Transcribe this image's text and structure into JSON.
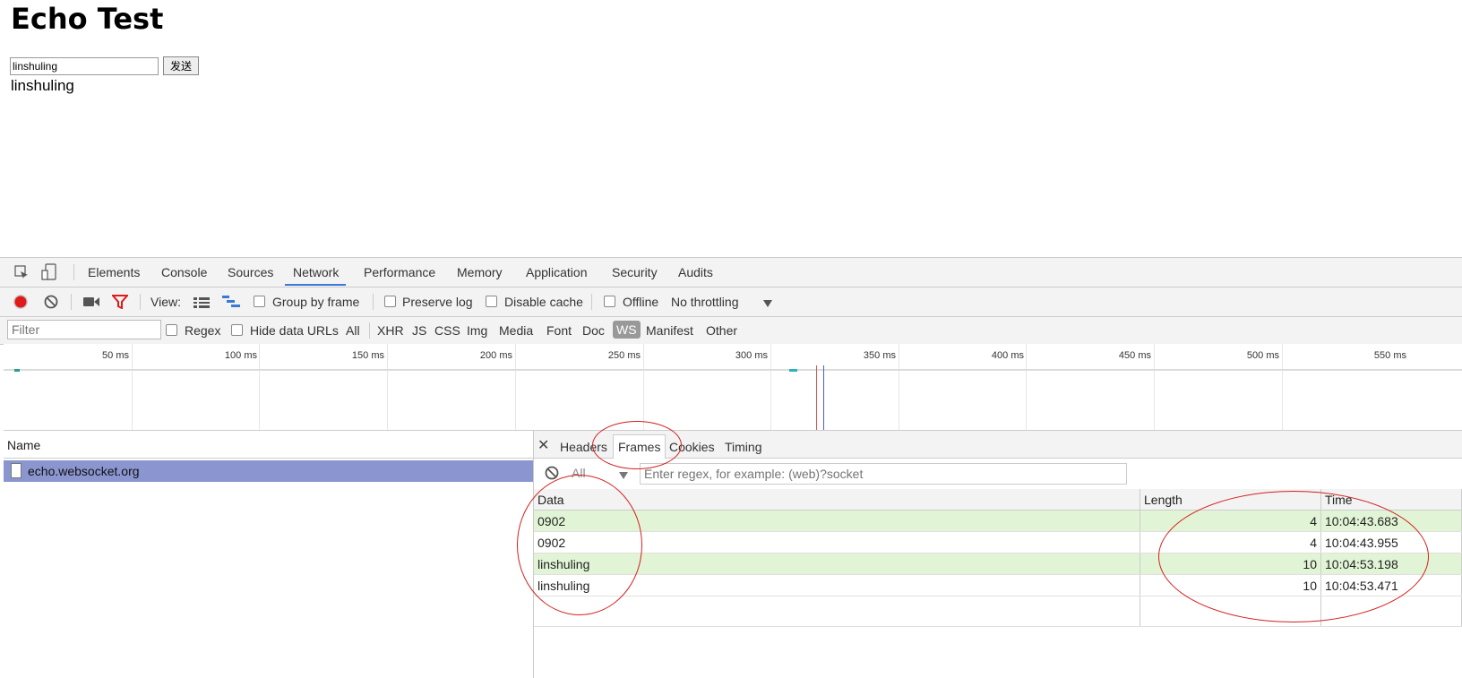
{
  "page": {
    "title": "Echo Test",
    "input_value": "linshuling",
    "send_label": "发送",
    "output_text": "linshuling"
  },
  "devtools": {
    "tabs": [
      "Elements",
      "Console",
      "Sources",
      "Network",
      "Performance",
      "Memory",
      "Application",
      "Security",
      "Audits"
    ],
    "active_tab": "Network",
    "toolbar": {
      "view_label": "View:",
      "group_by_frame": "Group by frame",
      "preserve_log": "Preserve log",
      "disable_cache": "Disable cache",
      "offline": "Offline",
      "throttling": "No throttling"
    },
    "filter": {
      "placeholder": "Filter",
      "regex": "Regex",
      "hide_data_urls": "Hide data URLs",
      "types": [
        "All",
        "XHR",
        "JS",
        "CSS",
        "Img",
        "Media",
        "Font",
        "Doc",
        "WS",
        "Manifest",
        "Other"
      ],
      "selected_type": "WS"
    },
    "timeline_ticks": [
      "50 ms",
      "100 ms",
      "150 ms",
      "200 ms",
      "250 ms",
      "300 ms",
      "350 ms",
      "400 ms",
      "450 ms",
      "500 ms",
      "550 ms"
    ],
    "name_header": "Name",
    "request_name": "echo.websocket.org",
    "detail_tabs": [
      "Headers",
      "Frames",
      "Cookies",
      "Timing"
    ],
    "active_detail_tab": "Frames",
    "frames_filter_all": "All",
    "frames_regex_placeholder": "Enter regex, for example: (web)?socket",
    "frames_columns": [
      "Data",
      "Length",
      "Time"
    ],
    "frames": [
      {
        "data": "0902",
        "length": "4",
        "time": "10:04:43.683",
        "sent": true
      },
      {
        "data": "0902",
        "length": "4",
        "time": "10:04:43.955",
        "sent": false
      },
      {
        "data": "linshuling",
        "length": "10",
        "time": "10:04:53.198",
        "sent": true
      },
      {
        "data": "linshuling",
        "length": "10",
        "time": "10:04:53.471",
        "sent": false
      }
    ],
    "colors": {
      "accent": "#3879d9",
      "record": "#e01a1a",
      "selected_row": "#8b96d1",
      "sent_frame": "#e1f5d6",
      "annotation": "#d42020"
    }
  }
}
